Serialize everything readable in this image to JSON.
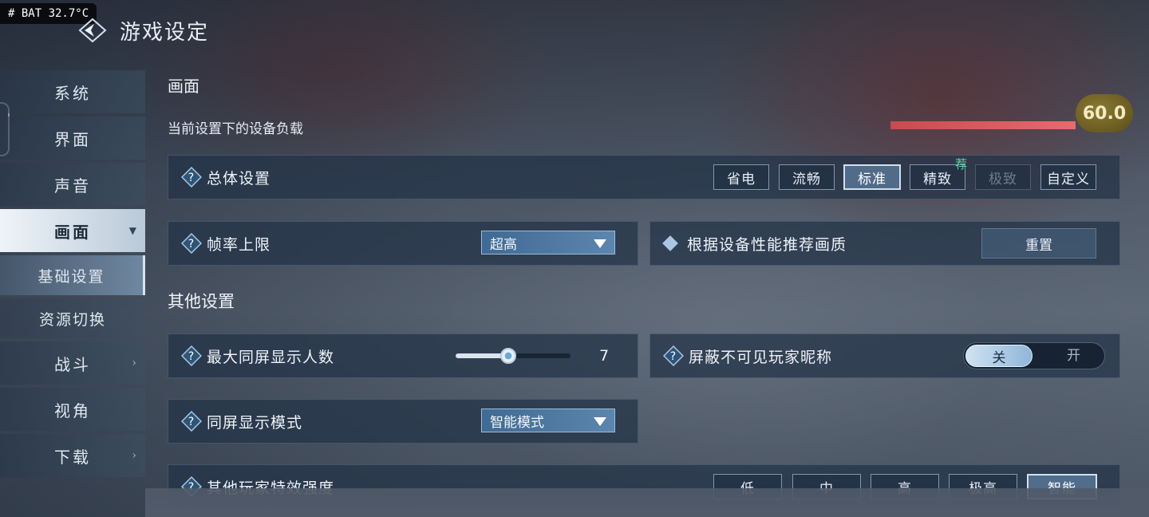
{
  "status": {
    "battery_text": "# BAT 32.7°C"
  },
  "header": {
    "title": "游戏设定",
    "icon": "game-logo-icon"
  },
  "sidebar": {
    "items": [
      {
        "label": "系统",
        "chevron": ""
      },
      {
        "label": "界面",
        "chevron": ""
      },
      {
        "label": "声音",
        "chevron": ""
      },
      {
        "label": "画面",
        "chevron": "▼",
        "active": true
      },
      {
        "label": "战斗",
        "chevron": "›"
      },
      {
        "label": "视角",
        "chevron": ""
      },
      {
        "label": "下载",
        "chevron": "›"
      }
    ],
    "subitems": [
      {
        "label": "基础设置",
        "selected": true
      },
      {
        "label": "资源切换",
        "selected": false
      }
    ]
  },
  "graphics": {
    "section_title": "画面",
    "device_load_label": "当前设置下的设备负载",
    "device_load_fraction": 0.9,
    "fps_value": "60.0",
    "overall": {
      "label": "总体设置",
      "options": [
        "省电",
        "流畅",
        "标准",
        "精致",
        "极致",
        "自定义"
      ],
      "selected": "标准",
      "recommended_badge": "荐",
      "disabled": [
        "极致"
      ]
    },
    "frame_rate": {
      "label": "帧率上限",
      "value": "超高"
    },
    "recommend": {
      "label": "根据设备性能推荐画质",
      "button": "重置"
    }
  },
  "other": {
    "section_title": "其他设置",
    "max_players": {
      "label": "最大同屏显示人数",
      "value": "7",
      "fraction": 0.46
    },
    "hide_names": {
      "label": "屏蔽不可见玩家昵称",
      "on_label": "关",
      "off_label": "开"
    },
    "display_mode": {
      "label": "同屏显示模式",
      "value": "智能模式"
    },
    "effects": {
      "label": "其他玩家特效强度",
      "options": [
        "低",
        "中",
        "高",
        "极高",
        "智能"
      ],
      "selected": "智能"
    }
  },
  "colors": {
    "accent": "#5c86ae",
    "load_bar": "#d95a5e",
    "recommend_green": "#58e0a0",
    "fps_badge": "#6e5f24"
  }
}
